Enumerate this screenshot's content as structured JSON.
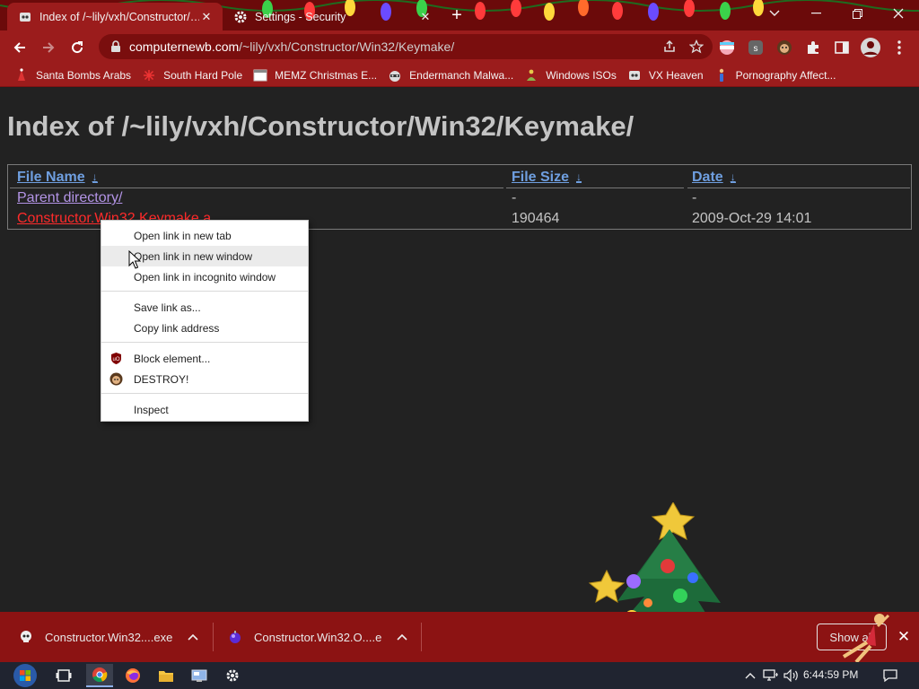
{
  "browser": {
    "tabs": [
      {
        "title": "Index of /~lily/vxh/Constructor/…",
        "active": true,
        "icon": "vx-heaven-icon"
      },
      {
        "title": "Settings - Security",
        "active": false,
        "icon": "gear-icon"
      }
    ],
    "url_host": "computernewb.com",
    "url_path": "/~lily/vxh/Constructor/Win32/Keymake/",
    "accent_color": "#9b1c1c"
  },
  "bookmarks": [
    {
      "label": "Santa Bombs Arabs"
    },
    {
      "label": "South Hard Pole"
    },
    {
      "label": "MEMZ Christmas E..."
    },
    {
      "label": "Endermanch Malwa..."
    },
    {
      "label": "Windows ISOs"
    },
    {
      "label": "VX Heaven"
    },
    {
      "label": "Pornography Affect..."
    }
  ],
  "page": {
    "title": "Index of /~lily/vxh/Constructor/Win32/Keymake/",
    "columns": {
      "name": "File Name",
      "size": "File Size",
      "date": "Date",
      "sort_glyph": "↓"
    },
    "rows": [
      {
        "name": "Parent directory/",
        "size": "-",
        "date": "-"
      },
      {
        "name": "Constructor.Win32.Keymake.a",
        "size": "190464",
        "date": "2009-Oct-29 14:01"
      }
    ]
  },
  "context_menu": {
    "items": [
      "Open link in new tab",
      "Open link in new window",
      "Open link in incognito window",
      "Save link as...",
      "Copy link address",
      "Block element...",
      "DESTROY!",
      "Inspect"
    ],
    "highlighted_index": 1
  },
  "downloads": {
    "items": [
      {
        "name": "Constructor.Win32....exe"
      },
      {
        "name": "Constructor.Win32.O....e"
      }
    ],
    "show_all": "Show all"
  },
  "taskbar": {
    "time": "6:44:59 PM"
  }
}
